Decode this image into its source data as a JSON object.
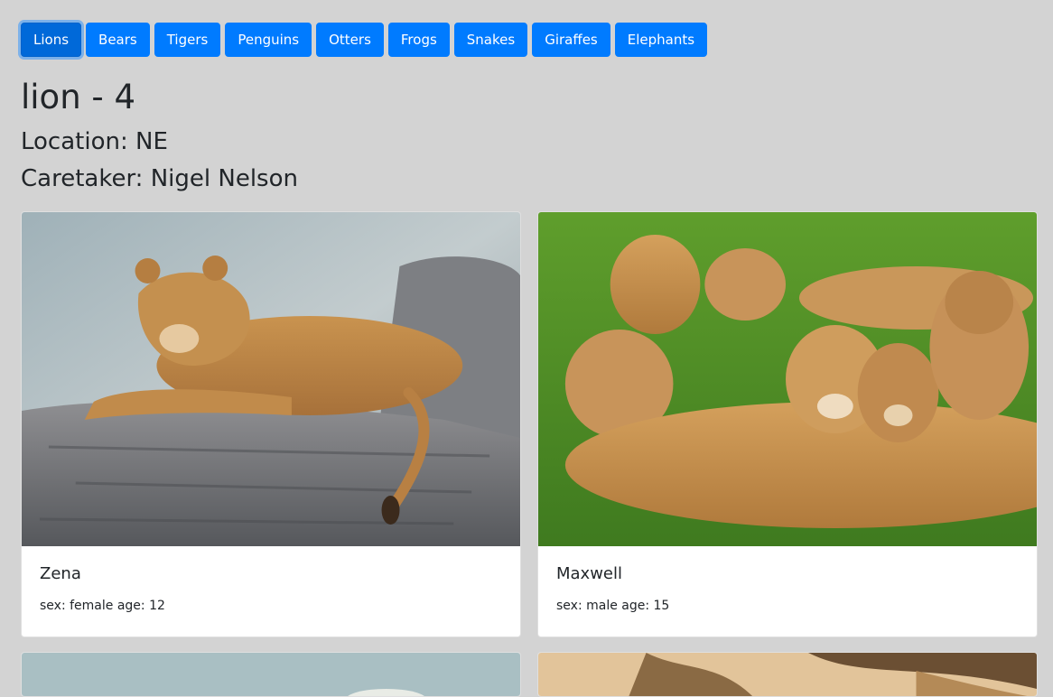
{
  "nav": {
    "buttons": [
      {
        "label": "Lions",
        "active": true
      },
      {
        "label": "Bears"
      },
      {
        "label": "Tigers"
      },
      {
        "label": "Penguins"
      },
      {
        "label": "Otters"
      },
      {
        "label": "Frogs"
      },
      {
        "label": "Snakes"
      },
      {
        "label": "Giraffes"
      },
      {
        "label": "Elephants"
      }
    ]
  },
  "header": {
    "title": "lion - 4",
    "location": "Location: NE",
    "caretaker": "Caretaker: Nigel Nelson"
  },
  "cards": [
    {
      "name": "Zena",
      "details": "sex: female age: 12"
    },
    {
      "name": "Maxwell",
      "details": "sex: male age: 15"
    },
    {
      "name": "",
      "details": ""
    },
    {
      "name": "",
      "details": ""
    }
  ],
  "colors": {
    "background": "#d3d3d3",
    "primary": "#007bff",
    "primary_active": "#0069d9"
  }
}
